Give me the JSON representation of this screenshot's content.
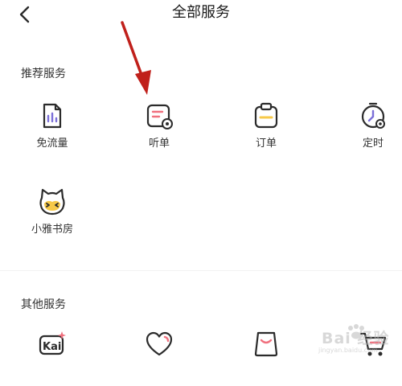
{
  "header": {
    "title": "全部服务",
    "back_icon": "chevron-left-icon"
  },
  "sections": {
    "recommended": {
      "title": "推荐服务",
      "items": [
        {
          "label": "免流量",
          "icon": "data-free-icon"
        },
        {
          "label": "听单",
          "icon": "listen-list-icon"
        },
        {
          "label": "订单",
          "icon": "order-clipboard-icon"
        },
        {
          "label": "定时",
          "icon": "timer-icon"
        },
        {
          "label": "小雅书房",
          "icon": "xiaoya-cat-icon"
        }
      ]
    },
    "other": {
      "title": "其他服务",
      "items": [
        {
          "label": "",
          "icon": "kai-sparkle-icon"
        },
        {
          "label": "",
          "icon": "heart-icon"
        },
        {
          "label": "",
          "icon": "smile-box-icon"
        },
        {
          "label": "",
          "icon": "shopping-cart-icon"
        }
      ]
    }
  },
  "colors": {
    "icon_stroke": "#2b2b2b",
    "accent_pink": "#f0707e",
    "accent_yellow": "#f7c948",
    "accent_purple": "#7b6fd8",
    "annotation_red": "#c0201b"
  },
  "watermark": {
    "text": "Bai 经验",
    "url": "jingyan.baidu.com"
  }
}
